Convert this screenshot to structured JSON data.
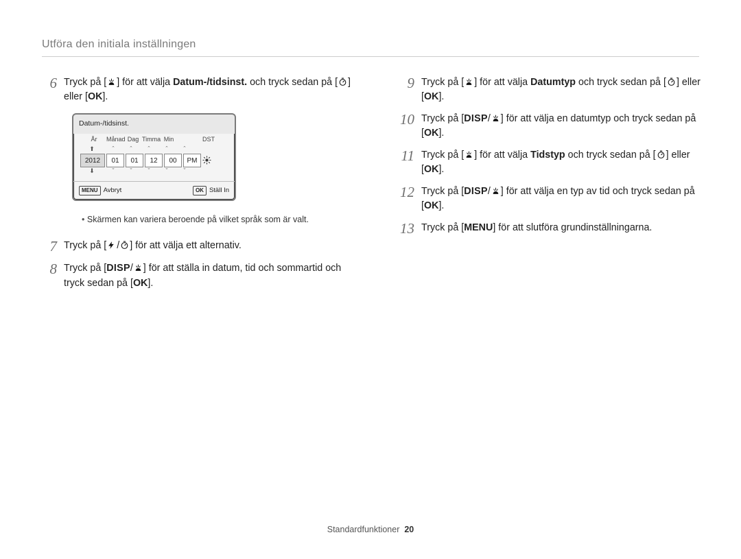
{
  "header": {
    "title": "Utföra den initiala inställningen"
  },
  "icons": {
    "macro": "macro-icon",
    "timer": "timer-icon",
    "ok": "OK",
    "disp": "DISP",
    "menu": "MENU",
    "flash": "flash-icon",
    "dst_off": "dst-off-icon"
  },
  "left": {
    "steps": [
      {
        "n": "6",
        "parts": [
          "Tryck på [",
          {
            "icon": "macro"
          },
          "] för att välja ",
          {
            "bold": "Datum-/tidsinst."
          },
          " och tryck sedan på [",
          {
            "icon": "timer"
          },
          "] eller [",
          {
            "ok": true
          },
          "]."
        ]
      },
      {
        "n": "7",
        "parts": [
          "Tryck på [",
          {
            "icon": "flash"
          },
          "/",
          {
            "icon": "timer"
          },
          "] för att välja ett alternativ."
        ]
      },
      {
        "n": "8",
        "parts": [
          "Tryck på [",
          {
            "disp": true
          },
          "/",
          {
            "icon": "macro"
          },
          "] för att ställa in datum, tid och sommartid och tryck sedan på [",
          {
            "ok": true
          },
          "]."
        ]
      }
    ],
    "note": "Skärmen kan variera beroende på vilket språk som är valt."
  },
  "lcd": {
    "title": "Datum-/tidsinst.",
    "labels": {
      "year": "År",
      "month": "Månad",
      "day": "Dag",
      "hour": "Timma",
      "min": "Min",
      "dst": "DST"
    },
    "values": {
      "year": "2012",
      "month": "01",
      "day": "01",
      "hour": "12",
      "min": "00",
      "ampm": "PM"
    },
    "footer": {
      "cancel_key": "MENU",
      "cancel": "Avbryt",
      "set_key": "OK",
      "set": "Ställ In"
    }
  },
  "right": {
    "steps": [
      {
        "n": "9",
        "parts": [
          "Tryck på [",
          {
            "icon": "macro"
          },
          "] för att välja ",
          {
            "bold": "Datumtyp"
          },
          " och tryck sedan på [",
          {
            "icon": "timer"
          },
          "] eller [",
          {
            "ok": true
          },
          "]."
        ]
      },
      {
        "n": "10",
        "parts": [
          "Tryck på [",
          {
            "disp": true
          },
          "/",
          {
            "icon": "macro"
          },
          "] för att välja en datumtyp och tryck sedan på [",
          {
            "ok": true
          },
          "]."
        ]
      },
      {
        "n": "11",
        "parts": [
          "Tryck på [",
          {
            "icon": "macro"
          },
          "] för att välja ",
          {
            "bold": "Tidstyp"
          },
          " och tryck sedan på [",
          {
            "icon": "timer"
          },
          "] eller [",
          {
            "ok": true
          },
          "]."
        ]
      },
      {
        "n": "12",
        "parts": [
          "Tryck på [",
          {
            "disp": true
          },
          "/",
          {
            "icon": "macro"
          },
          "] för att välja en typ av tid och tryck sedan på [",
          {
            "ok": true
          },
          "]."
        ]
      },
      {
        "n": "13",
        "parts": [
          "Tryck på [",
          {
            "menu": true
          },
          "] för att slutföra grundinställningarna."
        ]
      }
    ]
  },
  "footer": {
    "section": "Standardfunktioner",
    "page": "20"
  }
}
